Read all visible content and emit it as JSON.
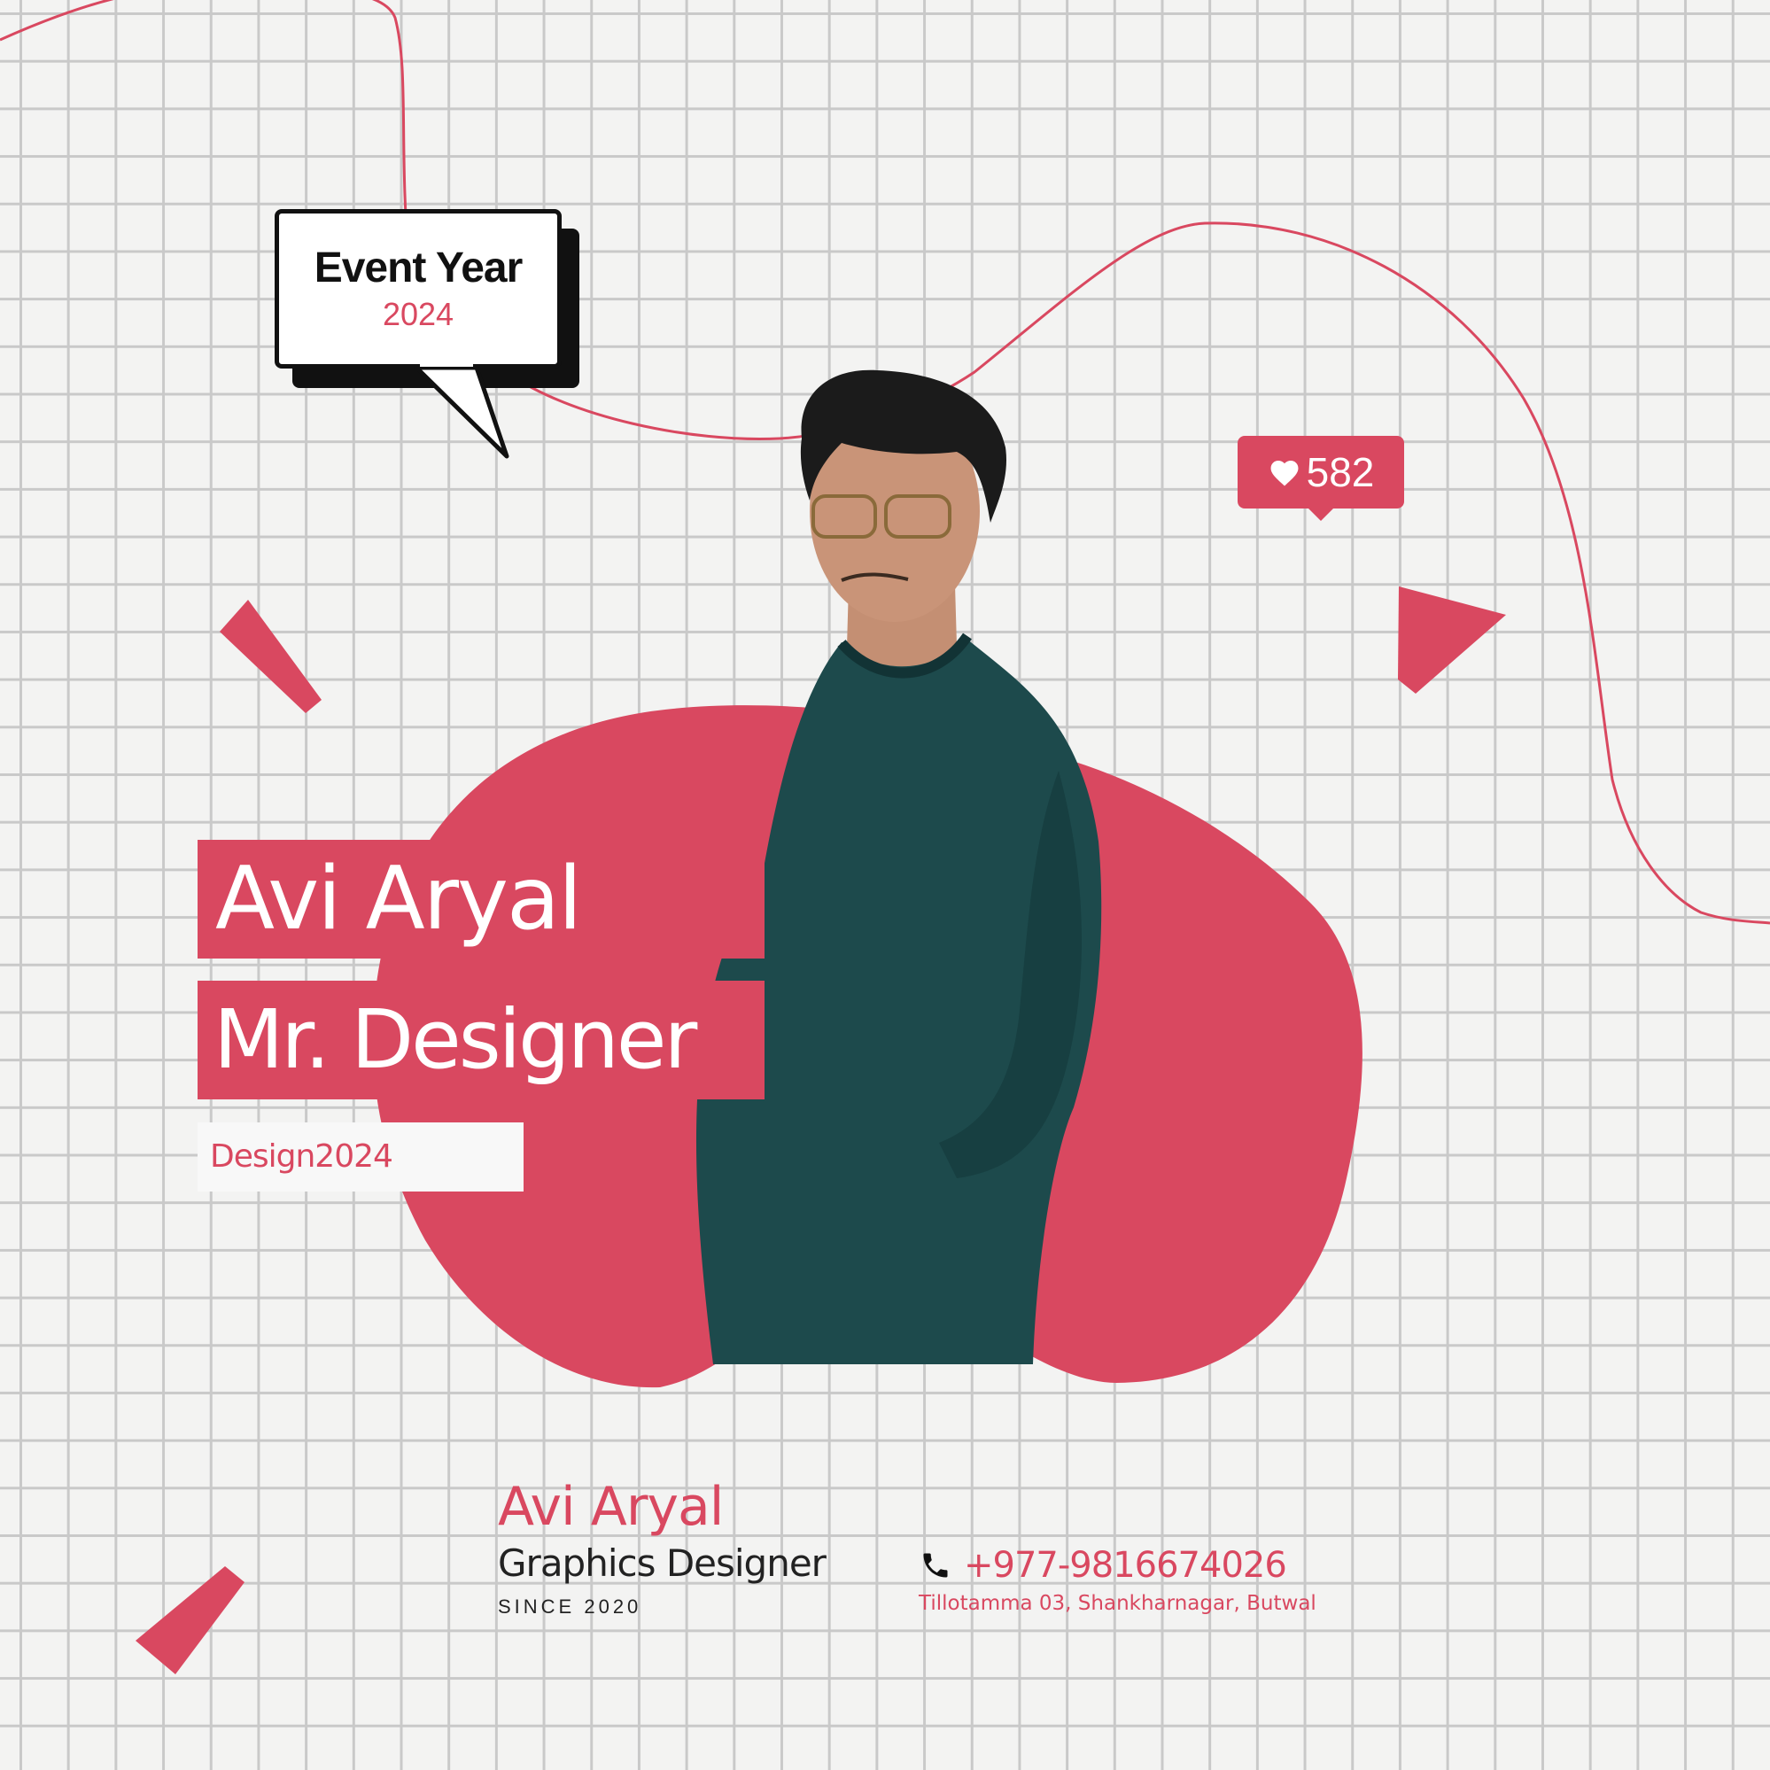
{
  "event_bubble": {
    "title": "Event Year",
    "year": "2024"
  },
  "likes": {
    "icon": "heart-icon",
    "count": "582"
  },
  "hero": {
    "name": "Avi Aryal",
    "title": "Mr. Designer",
    "tag": "Design2024"
  },
  "footer": {
    "name": "Avi Aryal",
    "role": "Graphics Designer",
    "since": "SINCE 2020",
    "phone_icon": "phone-icon",
    "phone": "+977-9816674026",
    "address": "Tillotamma 03, Shankharnagar, Butwal"
  },
  "colors": {
    "accent": "#d94860",
    "background": "#f3f3f2",
    "grid": "#c9c9c9",
    "ink": "#111111",
    "shirt": "#1d4a4c"
  }
}
